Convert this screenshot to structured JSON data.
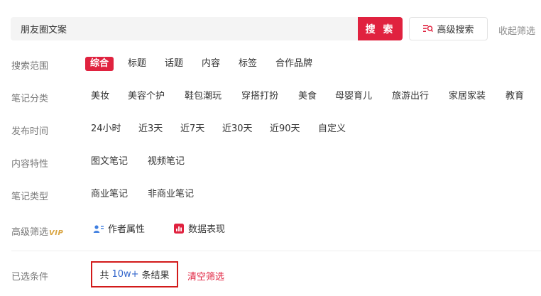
{
  "search": {
    "value": "朋友圈文案",
    "button_label": "搜 索"
  },
  "advanced_search_label": "高级搜索",
  "collapse_label": "收起筛选",
  "rows": {
    "scope": {
      "label": "搜索范围",
      "options": [
        "综合",
        "标题",
        "话题",
        "内容",
        "标签",
        "合作品牌"
      ],
      "active": "综合"
    },
    "category": {
      "label": "笔记分类",
      "options": [
        "美妆",
        "美容个护",
        "鞋包潮玩",
        "穿搭打扮",
        "美食",
        "母婴育儿",
        "旅游出行",
        "家居家装",
        "教育"
      ]
    },
    "time": {
      "label": "发布时间",
      "options": [
        "24小时",
        "近3天",
        "近7天",
        "近30天",
        "近90天",
        "自定义"
      ]
    },
    "feature": {
      "label": "内容特性",
      "options": [
        "图文笔记",
        "视频笔记"
      ]
    },
    "type": {
      "label": "笔记类型",
      "options": [
        "商业笔记",
        "非商业笔记"
      ]
    },
    "advanced": {
      "label": "高级筛选",
      "vip_badge": "VIP",
      "options": [
        "作者属性",
        "数据表现"
      ]
    }
  },
  "selected": {
    "label": "已选条件",
    "result_prefix": "共",
    "result_count": "10w+",
    "result_suffix": "条结果",
    "clear_label": "清空筛选"
  },
  "colors": {
    "accent": "#e0223f",
    "count_blue": "#3366cc",
    "highlight_border": "#d21a1a",
    "vip_gold": "#d9a440"
  },
  "icons": {
    "advanced_search": "search-filter-icon",
    "author": "user-group-icon",
    "data": "chart-icon"
  }
}
